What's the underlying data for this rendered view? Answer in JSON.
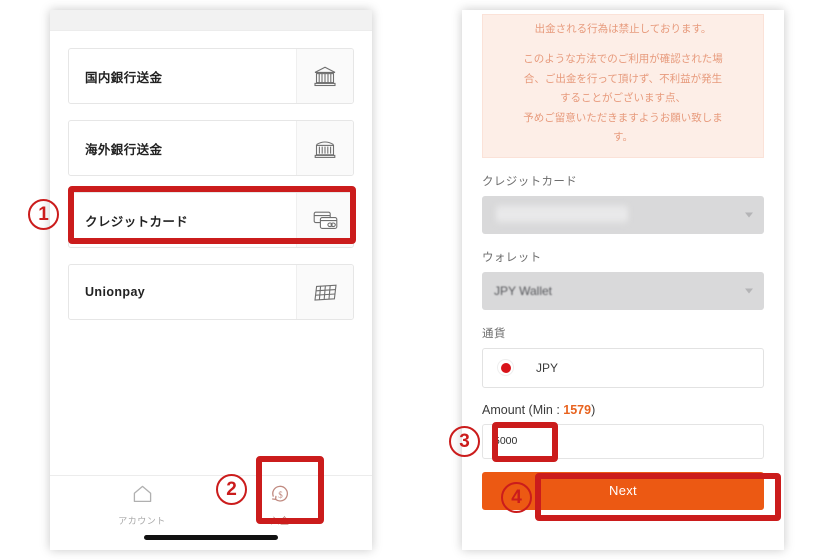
{
  "left_phone": {
    "methods": [
      {
        "label": "国内銀行送金",
        "icon": "bank-domestic-icon"
      },
      {
        "label": "海外銀行送金",
        "icon": "bank-overseas-icon"
      },
      {
        "label": "クレジットカード",
        "icon": "credit-card-icon"
      },
      {
        "label": "Unionpay",
        "icon": "unionpay-card-icon"
      }
    ],
    "tabbar": {
      "items": [
        {
          "label": "アカウント",
          "icon": "home-icon"
        },
        {
          "label": "入金",
          "icon": "deposit-dollar-icon"
        }
      ]
    }
  },
  "right_phone": {
    "notice": {
      "line1": "出金される行為は禁止しております。",
      "line2": "このような方法でのご利用が確認された場",
      "line3": "合、ご出金を行って頂けず、不利益が発生",
      "line4": "することがございます点、",
      "line5": "予めご留意いただきますようお願い致しま",
      "line6": "す。"
    },
    "credit_card": {
      "label": "クレジットカード",
      "value": ""
    },
    "wallet": {
      "label": "ウォレット",
      "value": "JPY Wallet"
    },
    "currency": {
      "label": "通貨",
      "selected": "JPY",
      "flag": "jp-flag-icon"
    },
    "amount": {
      "label_prefix": "Amount (Min : ",
      "min": "1579",
      "label_suffix": ")",
      "value": "5000"
    },
    "next_button": "Next"
  },
  "annotations": {
    "n1": "①",
    "n2": "②",
    "n3": "③",
    "n4": "④",
    "highlight_color": "#cb1c1c"
  }
}
